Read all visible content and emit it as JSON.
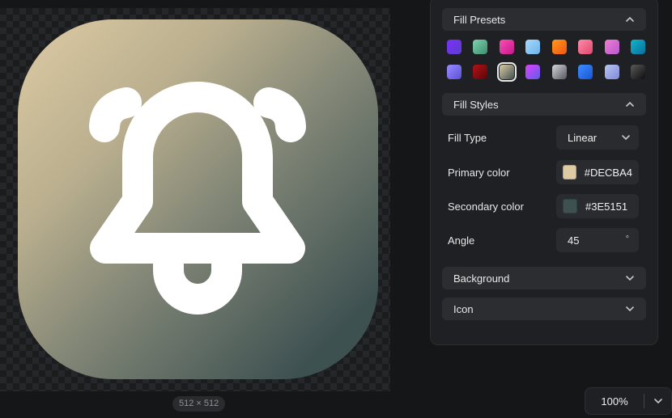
{
  "canvas": {
    "size_label": "512 × 512",
    "icon_name": "bell-ring-icon"
  },
  "panel": {
    "fill_presets": {
      "title": "Fill Presets",
      "swatches": [
        [
          "#7B2FF7",
          "#5A3FD0"
        ],
        [
          "#7FD1AE",
          "#3E8E6E"
        ],
        [
          "#FF4FB6",
          "#C2188B"
        ],
        [
          "#A6D8FF",
          "#6EB3E8"
        ],
        [
          "#FF9A1F",
          "#F2540F"
        ],
        [
          "#FF8CA8",
          "#E04870"
        ],
        [
          "#F27AD2",
          "#B45BCF"
        ],
        [
          "#12B5C9",
          "#0A6E9E"
        ],
        [
          "#9A8CFF",
          "#5B4FD9"
        ],
        [
          "#B31217",
          "#5A0608"
        ],
        [
          "#DECBA4",
          "#3E5151"
        ],
        [
          "#E040FB",
          "#5B5FE8"
        ],
        [
          "#D5D5DD",
          "#56565E"
        ],
        [
          "#3C8CFF",
          "#1A55D6"
        ],
        [
          "#B8C3F0",
          "#7E8BD8"
        ],
        [
          "#5A5A5A",
          "#0E0E0E"
        ]
      ],
      "selected_index": 10
    },
    "fill_styles": {
      "title": "Fill Styles",
      "fill_type_label": "Fill Type",
      "fill_type_value": "Linear",
      "primary_label": "Primary color",
      "primary_value": "#DECBA4",
      "secondary_label": "Secondary color",
      "secondary_value": "#3E5151",
      "angle_label": "Angle",
      "angle_value": "45",
      "angle_unit": "°"
    },
    "background": {
      "title": "Background"
    },
    "icon": {
      "title": "Icon"
    }
  },
  "zoom": {
    "value": "100%"
  },
  "colors": {
    "primary": "#DECBA4",
    "secondary": "#3E5151"
  }
}
